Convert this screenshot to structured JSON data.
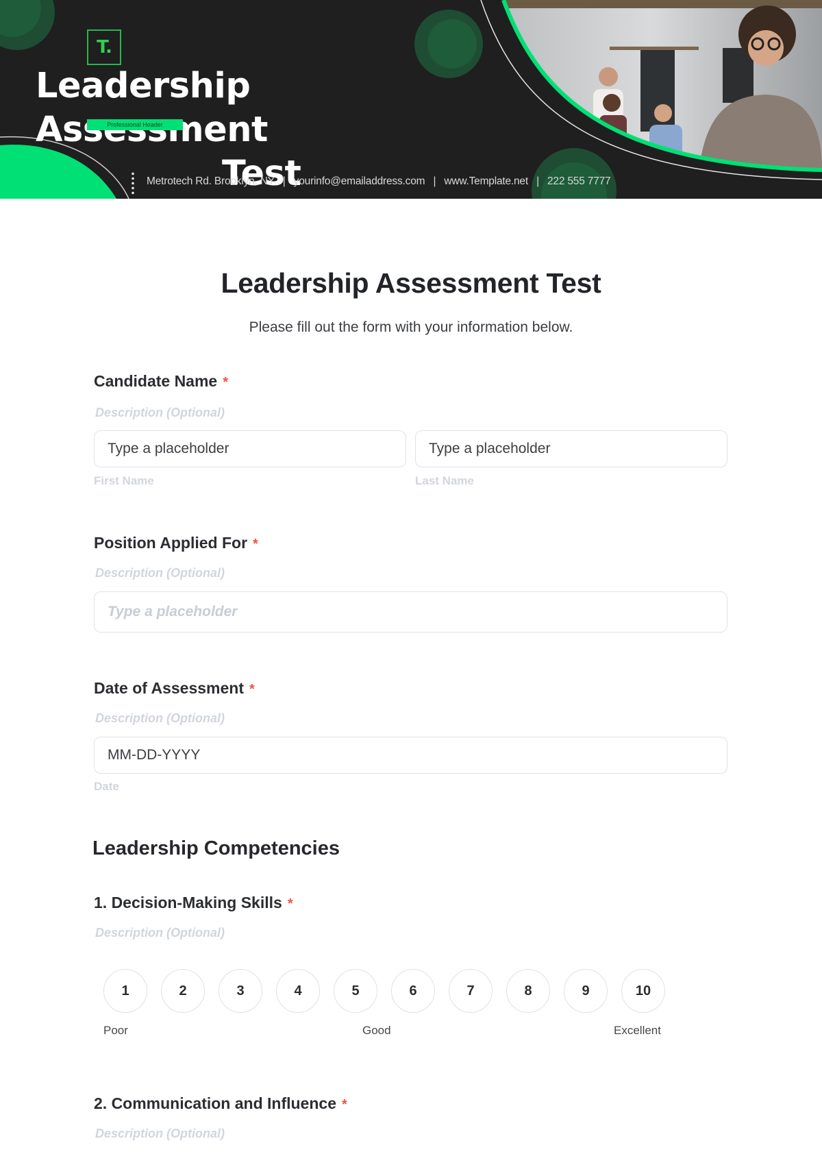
{
  "banner": {
    "logo_text": "T.",
    "title_line1": "Leadership Assessment",
    "title_line2": "Test",
    "tagline": "Professional Header",
    "contact": {
      "address": "Metrotech Rd. Brooklyn, NY",
      "email": "yourinfo@emailaddress.com",
      "website": "www.Template.net",
      "phone": "222 555 7777",
      "separator": "|"
    },
    "colors": {
      "background": "#1f1f1f",
      "accent": "#00e075",
      "dark_accent": "#1e5c3a"
    }
  },
  "form": {
    "title": "Leadership Assessment Test",
    "subtitle": "Please fill out the form with your information below.",
    "required_marker": "*",
    "fields": [
      {
        "label": "Candidate Name",
        "description": "Description (Optional)",
        "inputs": [
          {
            "placeholder": "Type a placeholder",
            "sublabel": "First Name"
          },
          {
            "placeholder": "Type a placeholder",
            "sublabel": "Last Name"
          }
        ]
      },
      {
        "label": "Position Applied For",
        "description": "Description (Optional)",
        "inputs": [
          {
            "placeholder": "Type a placeholder"
          }
        ]
      },
      {
        "label": "Date of Assessment",
        "description": "Description (Optional)",
        "inputs": [
          {
            "placeholder": "MM-DD-YYYY",
            "sublabel": "Date"
          }
        ]
      }
    ],
    "section": {
      "title": "Leadership Competencies",
      "questions": [
        {
          "label": "1. Decision-Making Skills",
          "description": "Description (Optional)",
          "scale": [
            "1",
            "2",
            "3",
            "4",
            "5",
            "6",
            "7",
            "8",
            "9",
            "10"
          ],
          "scale_labels": {
            "low": "Poor",
            "mid": "Good",
            "high": "Excellent"
          }
        },
        {
          "label": "2. Communication and Influence",
          "description": "Description (Optional)"
        }
      ]
    },
    "colors": {
      "required": "#f2533f",
      "muted": "#d1d5dc",
      "border": "#dfe2e8"
    }
  }
}
